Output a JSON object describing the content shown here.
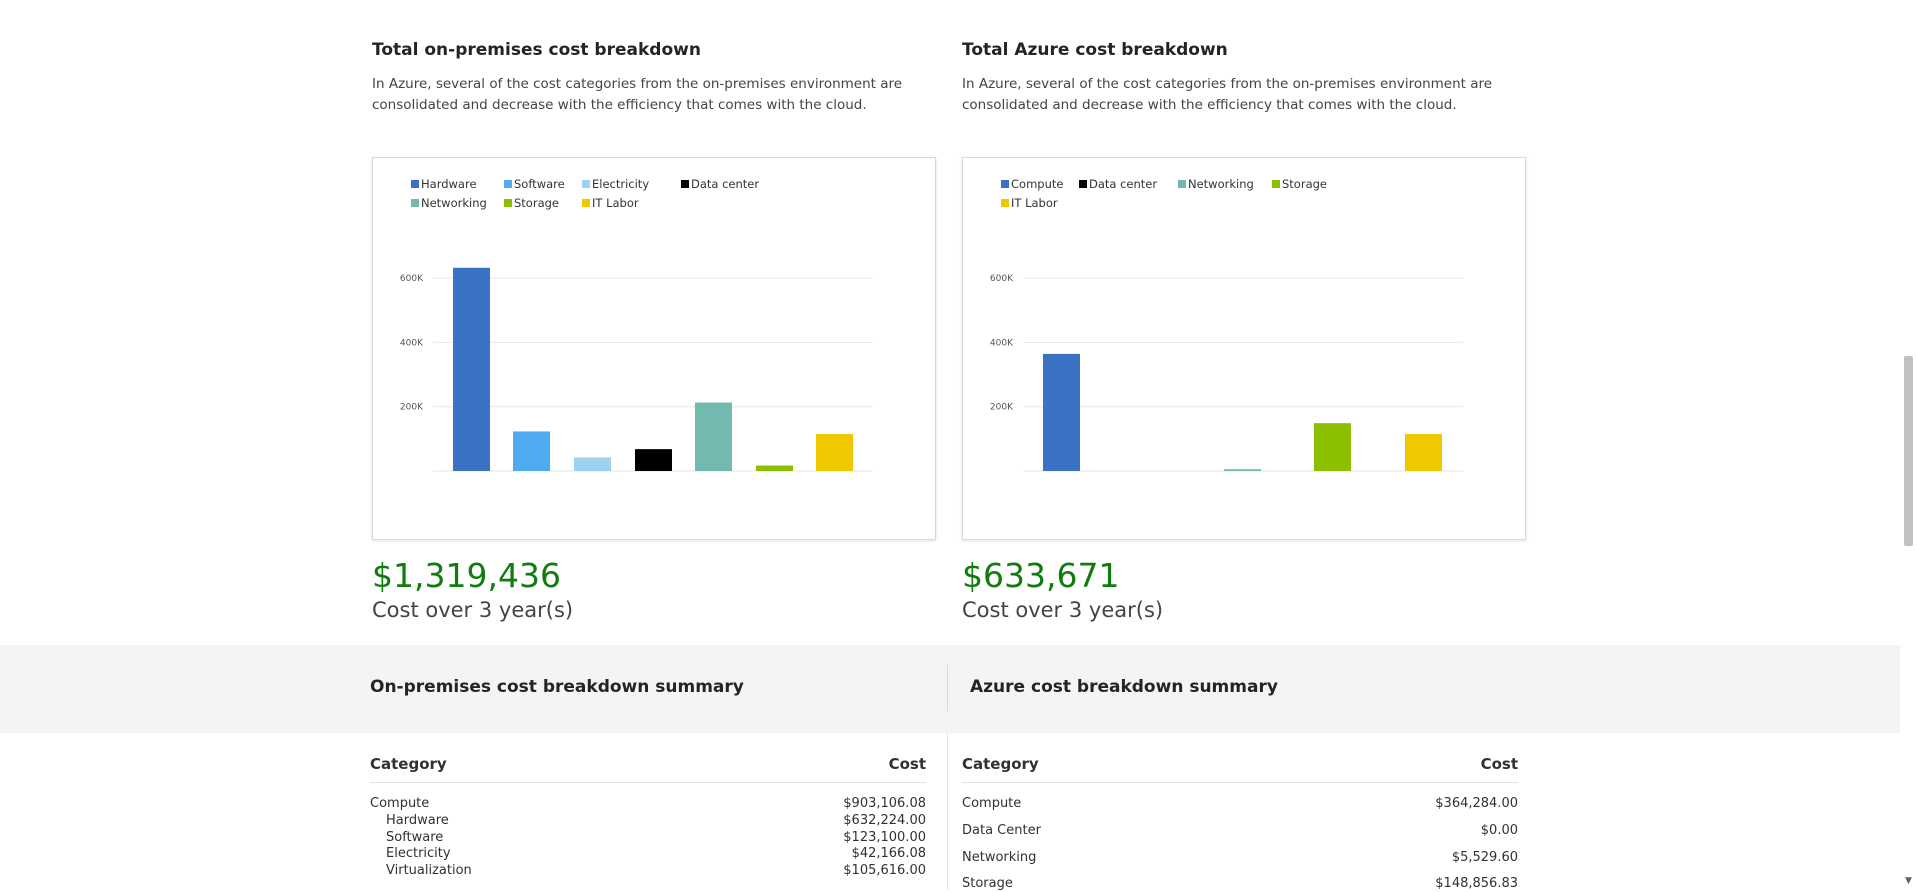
{
  "onprem": {
    "title": "Total on-premises cost breakdown",
    "description": "In Azure, several of the cost categories from the on-premises environment are consolidated and decrease with the efficiency that comes with the cloud.",
    "total": "$1,319,436",
    "total_caption": "Cost over 3 year(s)"
  },
  "azure": {
    "title": "Total Azure cost breakdown",
    "description": "In Azure, several of the cost categories from the on-premises environment are consolidated and decrease with the efficiency that comes with the cloud.",
    "total": "$633,671",
    "total_caption": "Cost over 3 year(s)"
  },
  "summary": {
    "onprem_title": "On-premises cost breakdown summary",
    "azure_title": "Azure cost breakdown summary",
    "header_category": "Category",
    "header_cost": "Cost",
    "onprem_rows": [
      {
        "name": "Compute",
        "cost": "$903,106.08"
      },
      {
        "name": "Hardware",
        "cost": "$632,224.00"
      },
      {
        "name": "Software",
        "cost": "$123,100.00"
      },
      {
        "name": "Electricity",
        "cost": "$42,166.08"
      },
      {
        "name": "Virtualization",
        "cost": "$105,616.00"
      }
    ],
    "azure_rows": [
      {
        "name": "Compute",
        "cost": "$364,284.00"
      },
      {
        "name": "Data Center",
        "cost": "$0.00"
      },
      {
        "name": "Networking",
        "cost": "$5,529.60"
      },
      {
        "name": "Storage",
        "cost": "$148,856.83"
      }
    ]
  },
  "chart_data": [
    {
      "type": "bar",
      "categories": [
        "Hardware",
        "Software",
        "Electricity",
        "Data center",
        "Networking",
        "Storage",
        "IT Labor"
      ],
      "values": [
        632224,
        123100,
        42166,
        68000,
        213000,
        17000,
        115000
      ],
      "colors": [
        "#3b73c4",
        "#4faaf0",
        "#9ed0f0",
        "#000000",
        "#72bab0",
        "#8cbf00",
        "#f0c800"
      ],
      "yticks": [
        200000,
        400000,
        600000
      ],
      "ytick_labels": [
        "200K",
        "400K",
        "600K"
      ],
      "ylim": [
        0,
        700000
      ],
      "legend_position": "top-left",
      "grid": true
    },
    {
      "type": "bar",
      "categories": [
        "Compute",
        "Data center",
        "Networking",
        "Storage",
        "IT Labor"
      ],
      "values": [
        364284,
        0,
        5530,
        148857,
        115000
      ],
      "colors": [
        "#3b73c4",
        "#000000",
        "#72bab0",
        "#8cbf00",
        "#f0c800"
      ],
      "yticks": [
        200000,
        400000,
        600000
      ],
      "ytick_labels": [
        "200K",
        "400K",
        "600K"
      ],
      "ylim": [
        0,
        700000
      ],
      "legend_position": "top-left",
      "grid": true
    }
  ]
}
